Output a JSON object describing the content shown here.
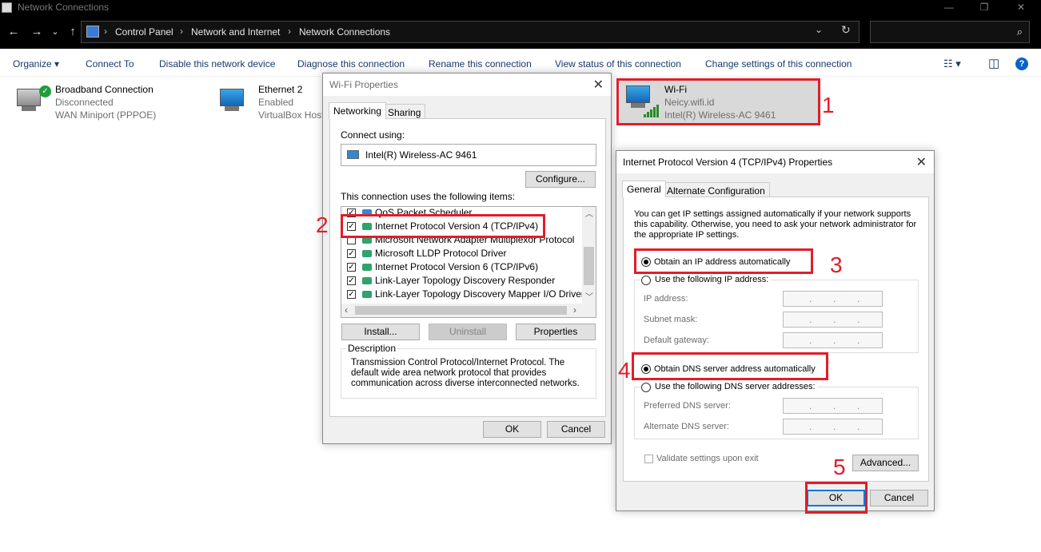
{
  "window": {
    "title": "Network Connections",
    "min": "—",
    "max": "❐",
    "close": "✕"
  },
  "nav": {
    "back": "←",
    "forward": "→",
    "recent": "⌄",
    "up": "↑"
  },
  "breadcrumb": {
    "items": [
      "Control Panel",
      "Network and Internet",
      "Network Connections"
    ],
    "sep": "›",
    "dropdown": "⌄",
    "refresh": "↻"
  },
  "search": {
    "placeholder": "",
    "icon": "⌕"
  },
  "commands": {
    "organize": "Organize ▾",
    "connect_to": "Connect To",
    "disable": "Disable this network device",
    "diagnose": "Diagnose this connection",
    "rename": "Rename this connection",
    "view_status": "View status of this connection",
    "change_settings": "Change settings of this connection",
    "view_icon": "☷ ▾",
    "pane_icon": "◫",
    "help": "?"
  },
  "connections": [
    {
      "name": "Broadband Connection",
      "status": "Disconnected",
      "device": "WAN Miniport (PPPOE)"
    },
    {
      "name": "Ethernet 2",
      "status": "Enabled",
      "device": "VirtualBox Host"
    },
    {
      "name": "Wi-Fi",
      "status": "Neicy.wifi.id",
      "device": "Intel(R) Wireless-AC 9461"
    }
  ],
  "wifi_props": {
    "title": "Wi-Fi Properties",
    "tabs": [
      "Networking",
      "Sharing"
    ],
    "connect_using": "Connect using:",
    "adapter": "Intel(R) Wireless-AC 9461",
    "configure": "Configure...",
    "items_label": "This connection uses the following items:",
    "items": [
      {
        "label": "QoS Packet Scheduler",
        "checked": true
      },
      {
        "label": "Internet Protocol Version 4 (TCP/IPv4)",
        "checked": true
      },
      {
        "label": "Microsoft Network Adapter Multiplexor Protocol",
        "checked": false
      },
      {
        "label": "Microsoft LLDP Protocol Driver",
        "checked": true
      },
      {
        "label": "Internet Protocol Version 6 (TCP/IPv6)",
        "checked": true
      },
      {
        "label": "Link-Layer Topology Discovery Responder",
        "checked": true
      },
      {
        "label": "Link-Layer Topology Discovery Mapper I/O Driver",
        "checked": true
      }
    ],
    "install": "Install...",
    "uninstall": "Uninstall",
    "properties": "Properties",
    "description_label": "Description",
    "description": "Transmission Control Protocol/Internet Protocol. The default wide area network protocol that provides communication across diverse interconnected networks.",
    "ok": "OK",
    "cancel": "Cancel"
  },
  "ipv4_props": {
    "title": "Internet Protocol Version 4 (TCP/IPv4) Properties",
    "tabs": [
      "General",
      "Alternate Configuration"
    ],
    "intro": "You can get IP settings assigned automatically if your network supports this capability. Otherwise, you need to ask your network administrator for the appropriate IP settings.",
    "obtain_ip": "Obtain an IP address automatically",
    "use_ip": "Use the following IP address:",
    "ip_address": "IP address:",
    "subnet_mask": "Subnet mask:",
    "default_gateway": "Default gateway:",
    "obtain_dns": "Obtain DNS server address automatically",
    "use_dns": "Use the following DNS server addresses:",
    "preferred_dns": "Preferred DNS server:",
    "alternate_dns": "Alternate DNS server:",
    "validate": "Validate settings upon exit",
    "advanced": "Advanced...",
    "ok": "OK",
    "cancel": "Cancel",
    "ip_dot": "."
  },
  "annotations": [
    "1",
    "2",
    "3",
    "4",
    "5"
  ],
  "colors": {
    "annotation": "#e11d2a",
    "accent": "#0078d7"
  }
}
